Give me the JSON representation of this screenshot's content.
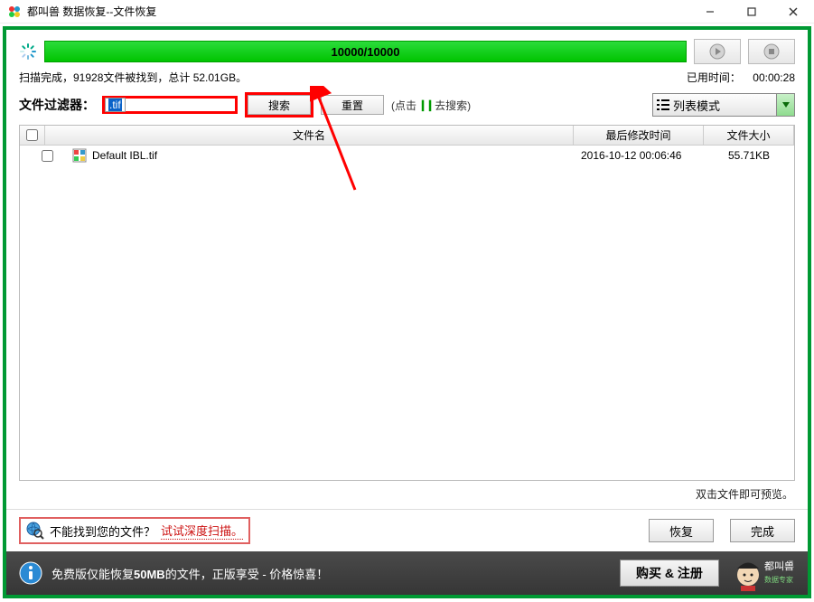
{
  "window": {
    "title": "都叫兽 数据恢复--文件恢复"
  },
  "progress": {
    "text": "10000/10000"
  },
  "status": {
    "scan_complete": "扫描完成，91928文件被找到，总计 52.01GB。",
    "elapsed_label": "已用时间：",
    "elapsed_value": "00:00:28"
  },
  "filter": {
    "label": "文件过滤器：",
    "input_value": ".tif",
    "search_btn": "搜索",
    "reset_btn": "重置",
    "hint_prefix": "(点击 ",
    "hint_suffix": " 去搜索)"
  },
  "view_mode": {
    "label": "列表模式"
  },
  "table": {
    "headers": {
      "name": "文件名",
      "time": "最后修改时间",
      "size": "文件大小"
    },
    "rows": [
      {
        "name": "Default IBL.tif",
        "time": "2016-10-12 00:06:46",
        "size": "55.71KB"
      }
    ],
    "preview_hint": "双击文件即可预览。"
  },
  "deep_scan": {
    "text_prefix": "不能找到您的文件？",
    "link": "试试深度扫描。"
  },
  "buttons": {
    "recover": "恢复",
    "finish": "完成"
  },
  "footer": {
    "text_a": "免费版仅能恢复",
    "text_bold": "50MB",
    "text_b": "的文件，正版享受 - 价格惊喜！",
    "buy_btn": "购买 & 注册",
    "brand": "都叫兽",
    "brand_sub": "数据专家"
  }
}
